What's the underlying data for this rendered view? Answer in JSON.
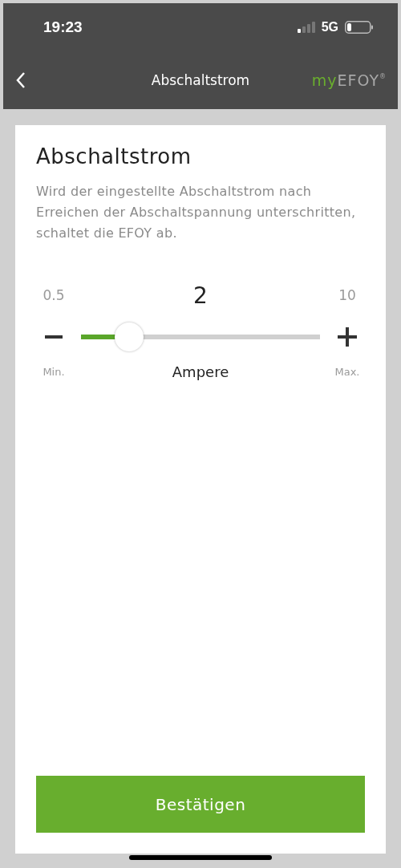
{
  "status_bar": {
    "time": "19:23",
    "network": "5G"
  },
  "nav": {
    "title": "Abschaltstrom",
    "logo": {
      "prefix": "my",
      "name": "EFOY",
      "mark": "®"
    }
  },
  "card": {
    "title": "Abschaltstrom",
    "description": "Wird der eingestellte Abschaltstrom nach Erreichen der Abschaltspannung unterschritten, schaltet die EFOY ab.",
    "slider": {
      "min": "0.5",
      "max": "10",
      "value": "2",
      "level": 0.2,
      "unit": "Ampere",
      "min_label": "Min.",
      "max_label": "Max."
    }
  },
  "confirm_button": "Bestätigen"
}
